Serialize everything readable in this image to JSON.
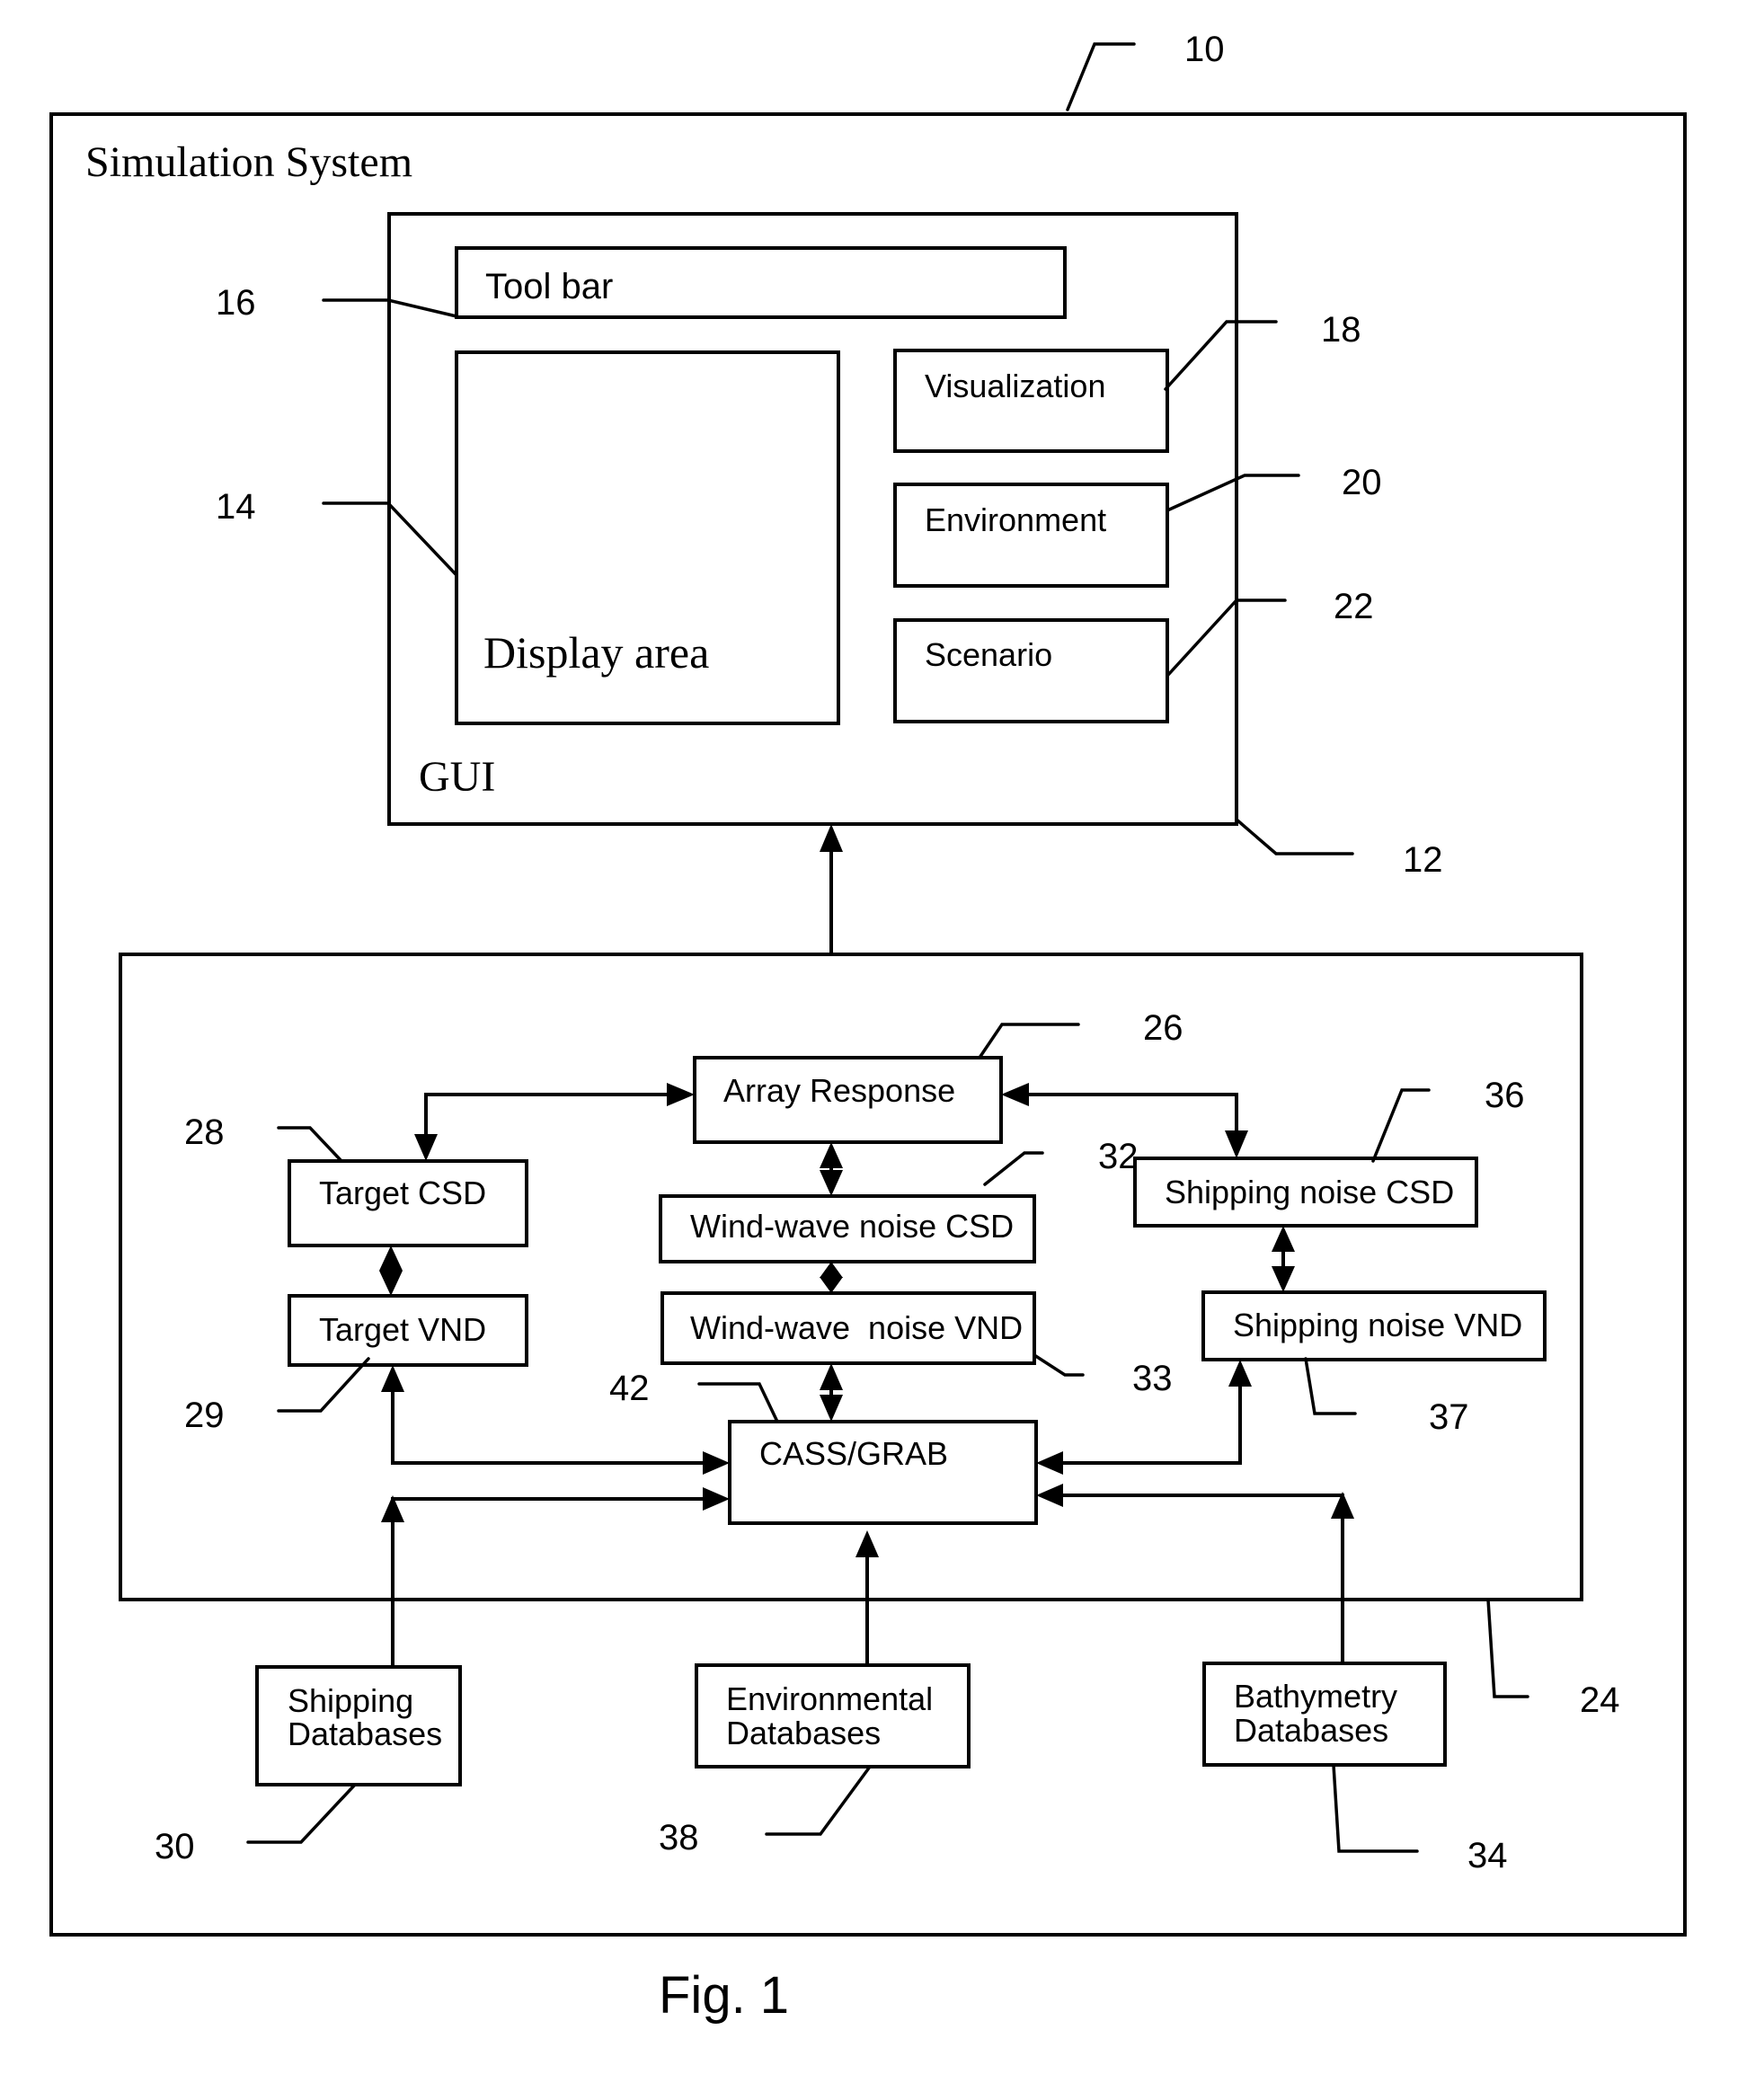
{
  "figure": {
    "caption": "Fig. 1",
    "system": {
      "title": "Simulation System",
      "ref": "10"
    },
    "gui": {
      "title": "GUI",
      "ref": "12",
      "toolbar": {
        "label": "Tool bar",
        "ref": "16"
      },
      "display_area": {
        "label": "Display area",
        "ref": "14"
      },
      "visualization": {
        "label": "Visualization",
        "ref": "18"
      },
      "environment": {
        "label": "Environment",
        "ref": "20"
      },
      "scenario": {
        "label": "Scenario",
        "ref": "22"
      }
    },
    "processing": {
      "ref": "24",
      "array_response": {
        "label": "Array Response",
        "ref": "26"
      },
      "target_csd": {
        "label": "Target CSD",
        "ref": "28"
      },
      "target_vnd": {
        "label": "Target VND",
        "ref": "29"
      },
      "wind_csd": {
        "label": "Wind-wave noise CSD",
        "ref": "32"
      },
      "wind_vnd": {
        "label": "Wind-wave  noise VND",
        "ref": "33"
      },
      "shipping_csd": {
        "label": "Shipping noise CSD",
        "ref": "36"
      },
      "shipping_vnd": {
        "label": "Shipping noise VND",
        "ref": "37"
      },
      "cass_grab": {
        "label": "CASS/GRAB",
        "ref": "42"
      }
    },
    "databases": {
      "shipping": {
        "line1": "Shipping",
        "line2": "Databases",
        "ref": "30"
      },
      "environmental": {
        "line1": "Environmental",
        "line2": "Databases",
        "ref": "38"
      },
      "bathymetry": {
        "line1": "Bathymetry",
        "line2": "Databases",
        "ref": "34"
      }
    }
  }
}
